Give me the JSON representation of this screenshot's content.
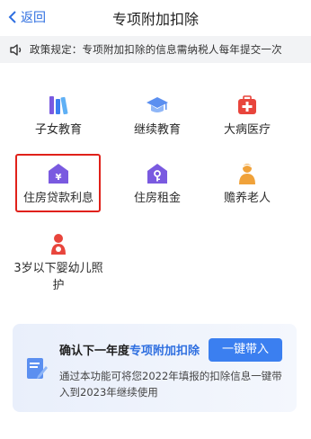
{
  "nav": {
    "back_label": "返回",
    "title": "专项附加扣除"
  },
  "notice": {
    "text": "政策规定：专项附加扣除的信息需纳税人每年提交一次"
  },
  "items": [
    {
      "label": "子女教育",
      "icon": "books-icon"
    },
    {
      "label": "继续教育",
      "icon": "graduation-cap-icon"
    },
    {
      "label": "大病医疗",
      "icon": "medical-kit-icon"
    },
    {
      "label": "住房贷款利息",
      "icon": "house-loan-icon"
    },
    {
      "label": "住房租金",
      "icon": "house-key-icon"
    },
    {
      "label": "赡养老人",
      "icon": "elderly-person-icon"
    },
    {
      "label": "3岁以下婴幼儿照护",
      "icon": "mother-baby-icon"
    }
  ],
  "card": {
    "title_prefix": "确认下一年度",
    "title_accent": "专项附加扣除",
    "button": "一键带入",
    "desc": "通过本功能可将您2022年填报的扣除信息一键带入到2023年继续使用",
    "icon": "document-pen-icon"
  },
  "colors": {
    "accent": "#2f6fe0",
    "icon_purple": "#7a5ae0",
    "icon_red": "#e8453c",
    "icon_orange": "#f0a23a",
    "highlight": "#e0211a"
  }
}
